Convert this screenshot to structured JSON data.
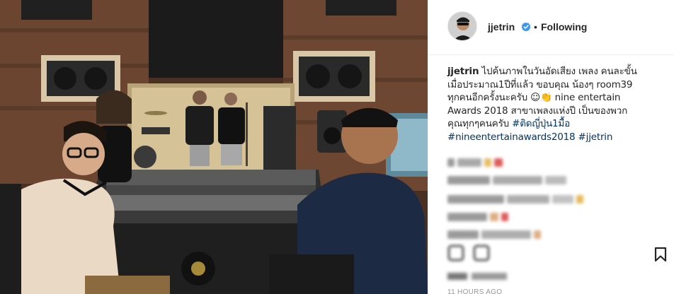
{
  "post": {
    "username": "jjetrin",
    "separator": "•",
    "follow_status": "Following",
    "caption": {
      "username": "jjetrin",
      "line1": "ไปค้นภาพในวันอัดเสียง เพลง คนละขั้น",
      "line2": "เมื่อประมาณ1ปีที่แล้ว ขอบคุณ น้องๆ room39",
      "line3": "ทุกคนอีกครั้งนะครับ ☺👏 nine entertain",
      "line4": "Awards 2018 สาขาเพลงแห่งปี เป็นของพวก",
      "line5_text": "คุณทุกๆคนครับ ",
      "line5_tag": "#ติดญี่ปุ่น1มื้อ",
      "line6_tag1": "#nineentertainawards2018",
      "line6_tag2": "#jjetrin"
    },
    "timestamp": "11 HOURS AGO"
  },
  "colors": {
    "hashtag": "#003569",
    "verified_badge": "#3897f0",
    "text": "#262626",
    "muted": "#999999"
  },
  "icons": {
    "verified": "verified-badge-icon",
    "bookmark": "bookmark-icon"
  }
}
